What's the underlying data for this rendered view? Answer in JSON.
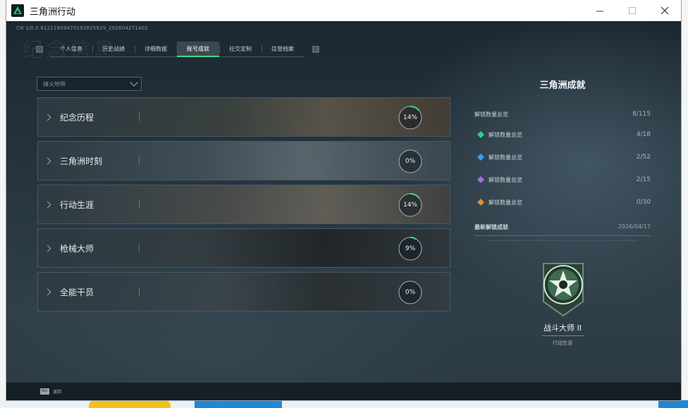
{
  "window": {
    "title": "三角洲行动"
  },
  "build_id": "CN 1/0.0.8121180947019282592​9_20260427140​2",
  "ghost_title": "纪念信息",
  "tabs": [
    {
      "label": "个人信息",
      "active": false
    },
    {
      "label": "历史战绩",
      "active": false
    },
    {
      "label": "详细数据",
      "active": false
    },
    {
      "label": "账号成就",
      "active": true
    },
    {
      "label": "社交定制",
      "active": false
    },
    {
      "label": "信誉档案",
      "active": false
    }
  ],
  "filter": {
    "value": "烽火地带"
  },
  "categories": [
    {
      "label": "纪念历程",
      "percent": 14,
      "percent_text": "14%"
    },
    {
      "label": "三角洲时刻",
      "percent": 0,
      "percent_text": "0%"
    },
    {
      "label": "行动生涯",
      "percent": 14,
      "percent_text": "14%"
    },
    {
      "label": "枪械大师",
      "percent": 9,
      "percent_text": "9%"
    },
    {
      "label": "全能干员",
      "percent": 0,
      "percent_text": "0%"
    }
  ],
  "panel": {
    "title": "三角洲成就",
    "total": {
      "label": "解锁数量总览",
      "value": "8/115"
    },
    "rows": [
      {
        "label": "解锁数量总览",
        "value": "4/18",
        "icon": "green-rank-icon",
        "color": "#2ecf8a"
      },
      {
        "label": "解锁数量总览",
        "value": "2/52",
        "icon": "blue-rank-icon",
        "color": "#3a9ee8"
      },
      {
        "label": "解锁数量总览",
        "value": "2/15",
        "icon": "purple-rank-icon",
        "color": "#9a6ee8"
      },
      {
        "label": "解锁数量总览",
        "value": "0/30",
        "icon": "orange-rank-icon",
        "color": "#e88a3a"
      }
    ],
    "latest": {
      "label": "最新解锁成就",
      "date": "2026/04/17"
    }
  },
  "badge": {
    "name": "战斗大师 II",
    "category": "行动生涯"
  },
  "footer": {
    "key": "Esc",
    "label": "返回"
  },
  "colors": {
    "accent": "#3ddc84",
    "progress": "#3ddc84"
  }
}
